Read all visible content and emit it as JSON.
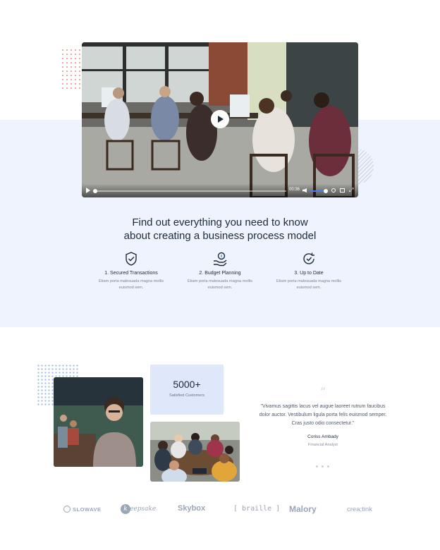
{
  "video": {
    "time": "00:36"
  },
  "heading": {
    "line1": "Find out everything you need to know",
    "line2": "about creating a business process model"
  },
  "features": [
    {
      "icon": "shield-check-icon",
      "title": "1. Secured Transactions",
      "desc": "Etiam porta malesuada magna mollis euismod sem."
    },
    {
      "icon": "hand-money-icon",
      "title": "2. Budget Planning",
      "desc": "Etiam porta malesuada magna mollis euismod sem."
    },
    {
      "icon": "refresh-check-icon",
      "title": "3. Up to Date",
      "desc": "Etiam porta malesuada magna mollis euismod sem."
    }
  ],
  "stats": {
    "number": "5000+",
    "label": "Satisfied Customers"
  },
  "testimonial": {
    "quote": "\"Vivamus sagittis lacus vel augue laoreet rutrum faucibus dolor auctor. Vestibulum ligula porta felis euismod semper. Cras justo odio consectetur.\"",
    "author": "Coriss Ambady",
    "role": "Financial Analyst"
  },
  "logos": {
    "slowave": "SLOWAVE",
    "keepsake": "eepsake",
    "keepsake_initial": "k",
    "skybox": "Skybox",
    "braille": "[ braille ]",
    "malory": "Malory",
    "creatink": "crea;tink"
  },
  "colors": {
    "band": "#eef3fd",
    "stat_card": "#dfe8fa",
    "accent_blue": "#4a7cf0",
    "text_dark": "#1e2a3a"
  }
}
